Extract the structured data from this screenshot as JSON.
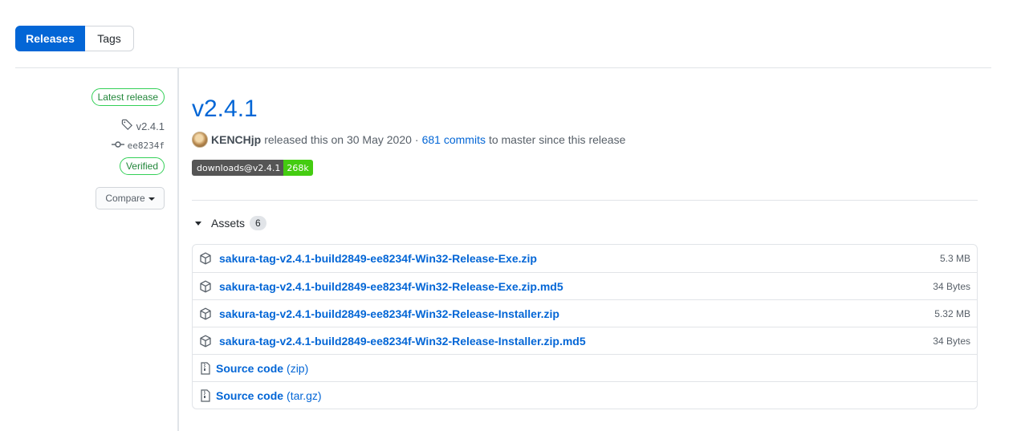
{
  "tabs": {
    "releases": "Releases",
    "tags": "Tags"
  },
  "sidebar": {
    "latest_label": "Latest release",
    "tag": "v2.4.1",
    "commit": "ee8234f",
    "verified": "Verified",
    "compare": "Compare"
  },
  "release": {
    "title": "v2.4.1",
    "author": "KENCHjp",
    "released_text": "released this on 30 May 2020",
    "separator": "·",
    "commits": "681 commits",
    "commits_suffix": "to master since this release"
  },
  "badge": {
    "label": "downloads@v2.4.1",
    "value": "268k",
    "value_color": "#44cc11"
  },
  "assets": {
    "heading": "Assets",
    "count": "6",
    "files": [
      {
        "name": "sakura-tag-v2.4.1-build2849-ee8234f-Win32-Release-Exe.zip",
        "size": "5.3 MB"
      },
      {
        "name": "sakura-tag-v2.4.1-build2849-ee8234f-Win32-Release-Exe.zip.md5",
        "size": "34 Bytes"
      },
      {
        "name": "sakura-tag-v2.4.1-build2849-ee8234f-Win32-Release-Installer.zip",
        "size": "5.32 MB"
      },
      {
        "name": "sakura-tag-v2.4.1-build2849-ee8234f-Win32-Release-Installer.zip.md5",
        "size": "34 Bytes"
      }
    ],
    "sources": [
      {
        "name": "Source code",
        "format": "(zip)"
      },
      {
        "name": "Source code",
        "format": "(tar.gz)"
      }
    ]
  },
  "colors": {
    "accent": "#0366d6",
    "success": "#22863a"
  },
  "icons": [
    "tag-icon",
    "commit-icon",
    "package-icon",
    "file-zip-icon",
    "triangle-down-icon"
  ]
}
